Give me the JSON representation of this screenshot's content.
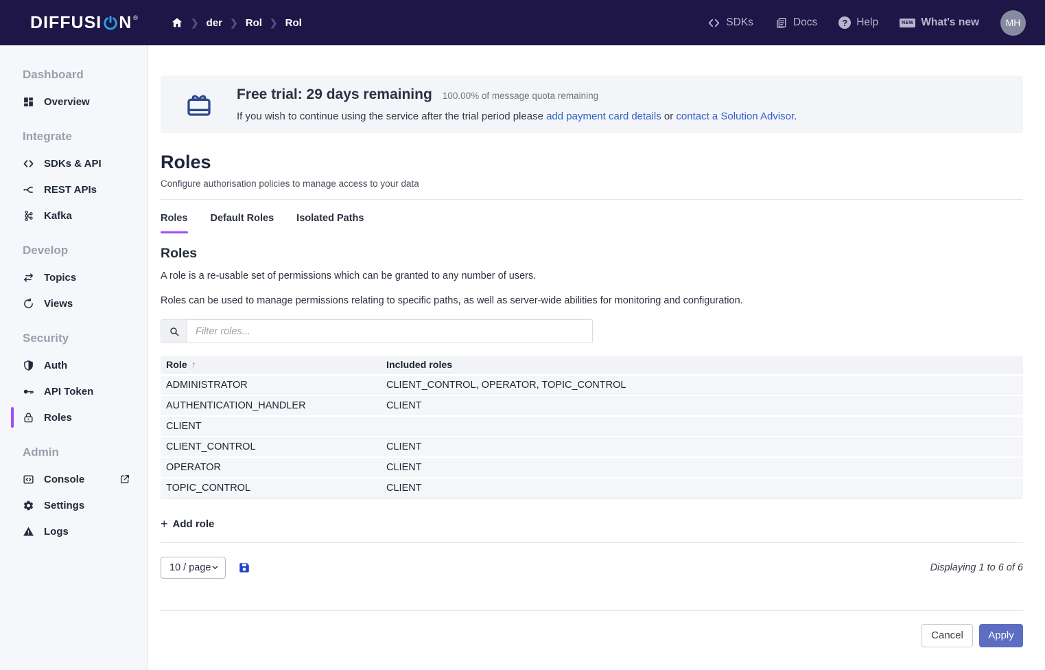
{
  "brand": {
    "name_left": "DIFFUSI",
    "name_right": "N",
    "registered": "®"
  },
  "navbar": {
    "breadcrumb": [
      "der",
      "Rol",
      "Rol"
    ],
    "links": {
      "sdks": "SDKs",
      "docs": "Docs",
      "help": "Help",
      "whats_new": "What's new"
    },
    "help_glyph": "?",
    "new_badge": "NEW",
    "avatar_initials": "MH"
  },
  "sidebar": {
    "sections": [
      {
        "title": "Dashboard",
        "items": [
          {
            "label": "Overview",
            "icon": "grid-icon"
          }
        ]
      },
      {
        "title": "Integrate",
        "items": [
          {
            "label": "SDKs & API",
            "icon": "code-icon"
          },
          {
            "label": "REST APIs",
            "icon": "fork-icon"
          },
          {
            "label": "Kafka",
            "icon": "kafka-icon"
          }
        ]
      },
      {
        "title": "Develop",
        "items": [
          {
            "label": "Topics",
            "icon": "swap-arrows-icon"
          },
          {
            "label": "Views",
            "icon": "refresh-icon"
          }
        ]
      },
      {
        "title": "Security",
        "items": [
          {
            "label": "Auth",
            "icon": "shield-icon"
          },
          {
            "label": "API Token",
            "icon": "key-icon"
          },
          {
            "label": "Roles",
            "icon": "lock-icon",
            "active": true
          }
        ]
      },
      {
        "title": "Admin",
        "items": [
          {
            "label": "Console",
            "icon": "console-icon",
            "external": true
          },
          {
            "label": "Settings",
            "icon": "gear-icon"
          },
          {
            "label": "Logs",
            "icon": "warning-icon"
          }
        ]
      }
    ]
  },
  "banner": {
    "title": "Free trial: 29 days remaining",
    "quota": "100.00% of message quota remaining",
    "text_before": "If you wish to continue using the service after the trial period please ",
    "link_payment": "add payment card details",
    "text_or": " or ",
    "link_advisor": "contact a Solution Advisor",
    "text_end": "."
  },
  "page": {
    "title": "Roles",
    "subtitle": "Configure authorisation policies to manage access to your data"
  },
  "tabs": [
    {
      "label": "Roles",
      "active": true
    },
    {
      "label": "Default Roles",
      "active": false
    },
    {
      "label": "Isolated Paths",
      "active": false
    }
  ],
  "roles_section": {
    "heading": "Roles",
    "description1": "A role is a re-usable set of permissions which can be granted to any number of users.",
    "description2": "Roles can be used to manage permissions relating to specific paths, as well as server-wide abilities for monitoring and configuration."
  },
  "filter": {
    "placeholder": "Filter roles..."
  },
  "table": {
    "sort_arrow": "↑",
    "columns": [
      {
        "label": "Role",
        "sorted": "ascending"
      },
      {
        "label": "Included roles"
      }
    ],
    "rows": [
      {
        "role": "ADMINISTRATOR",
        "included": "CLIENT_CONTROL, OPERATOR, TOPIC_CONTROL"
      },
      {
        "role": "AUTHENTICATION_HANDLER",
        "included": "CLIENT"
      },
      {
        "role": "CLIENT",
        "included": ""
      },
      {
        "role": "CLIENT_CONTROL",
        "included": "CLIENT"
      },
      {
        "role": "OPERATOR",
        "included": "CLIENT"
      },
      {
        "role": "TOPIC_CONTROL",
        "included": "CLIENT"
      }
    ]
  },
  "actions": {
    "add_plus": "+",
    "add_role": "Add role"
  },
  "pagination": {
    "page_size": "10 / page",
    "displaying": "Displaying 1 to 6 of 6"
  },
  "footer": {
    "cancel": "Cancel",
    "apply": "Apply"
  },
  "colors": {
    "navbar_bg": "#1d1646",
    "accent_purple": "#a04ef5",
    "link_blue": "#3060c8",
    "apply_bg": "#5c6dc2",
    "save_blue": "#1c46cc",
    "logo_power_blue": "#2d9fe3",
    "banner_bg": "#f3f5f9",
    "row_bg": "#f5f6f9"
  }
}
